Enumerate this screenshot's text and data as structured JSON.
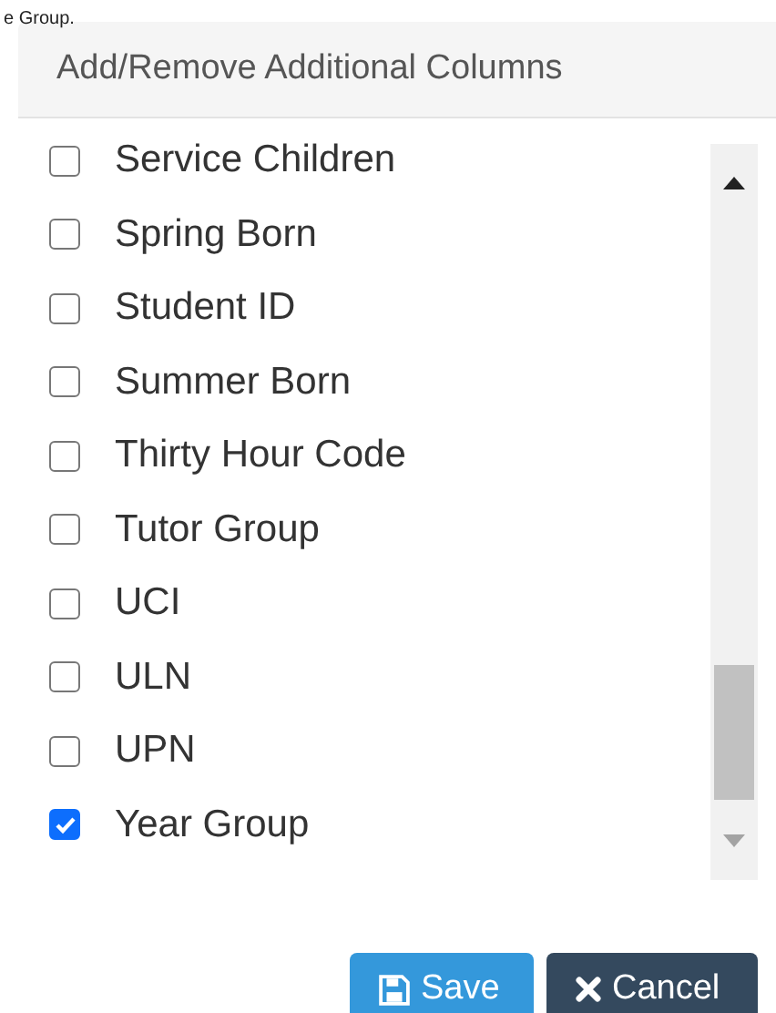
{
  "heading_fragment": "e Group.",
  "panel": {
    "title": "Add/Remove Additional Columns"
  },
  "columns": [
    {
      "label": "Service Children",
      "checked": false
    },
    {
      "label": "Spring Born",
      "checked": false
    },
    {
      "label": "Student ID",
      "checked": false
    },
    {
      "label": "Summer Born",
      "checked": false
    },
    {
      "label": "Thirty Hour Code",
      "checked": false
    },
    {
      "label": "Tutor Group",
      "checked": false
    },
    {
      "label": "UCI",
      "checked": false
    },
    {
      "label": "ULN",
      "checked": false
    },
    {
      "label": "UPN",
      "checked": false
    },
    {
      "label": "Year Group",
      "checked": true
    }
  ],
  "buttons": [
    {
      "kind": "save",
      "label": "Save"
    },
    {
      "kind": "cancel",
      "label": "Cancel"
    }
  ]
}
